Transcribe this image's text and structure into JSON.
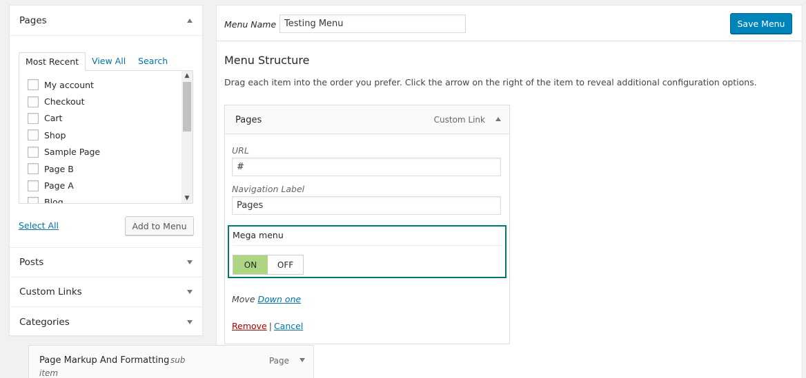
{
  "left_panel": {
    "pages_section": {
      "title": "Pages",
      "tabs": [
        {
          "label": "Most Recent",
          "active": true
        },
        {
          "label": "View All",
          "active": false
        },
        {
          "label": "Search",
          "active": false
        }
      ],
      "items": [
        "My account",
        "Checkout",
        "Cart",
        "Shop",
        "Sample Page",
        "Page B",
        "Page A",
        "Blog"
      ],
      "select_all": "Select All",
      "add_button": "Add to Menu"
    },
    "sections": [
      {
        "title": "Posts"
      },
      {
        "title": "Custom Links"
      },
      {
        "title": "Categories"
      }
    ]
  },
  "top_bar": {
    "menu_name_label": "Menu Name",
    "menu_name_value": "Testing Menu",
    "save_button": "Save Menu"
  },
  "menu_structure": {
    "title": "Menu Structure",
    "description": "Drag each item into the order you prefer. Click the arrow on the right of the item to reveal additional configuration options."
  },
  "menu_item": {
    "title": "Pages",
    "type": "Custom Link",
    "url_label": "URL",
    "url_value": "#",
    "nav_label": "Navigation Label",
    "nav_value": "Pages",
    "mega_menu_label": "Mega menu",
    "toggle_on": "ON",
    "toggle_off": "OFF",
    "move_label": "Move",
    "move_link": "Down one",
    "remove_link": "Remove",
    "separator": "|",
    "cancel_link": "Cancel"
  },
  "sub_item": {
    "title": "Page Markup And Formatting",
    "badge": "sub",
    "badge2": "item",
    "type": "Page"
  },
  "colors": {
    "accent": "#0085ba",
    "link": "#0073aa",
    "mega_border": "#00796b",
    "toggle_on": "#aed581",
    "remove": "#aa0000"
  }
}
